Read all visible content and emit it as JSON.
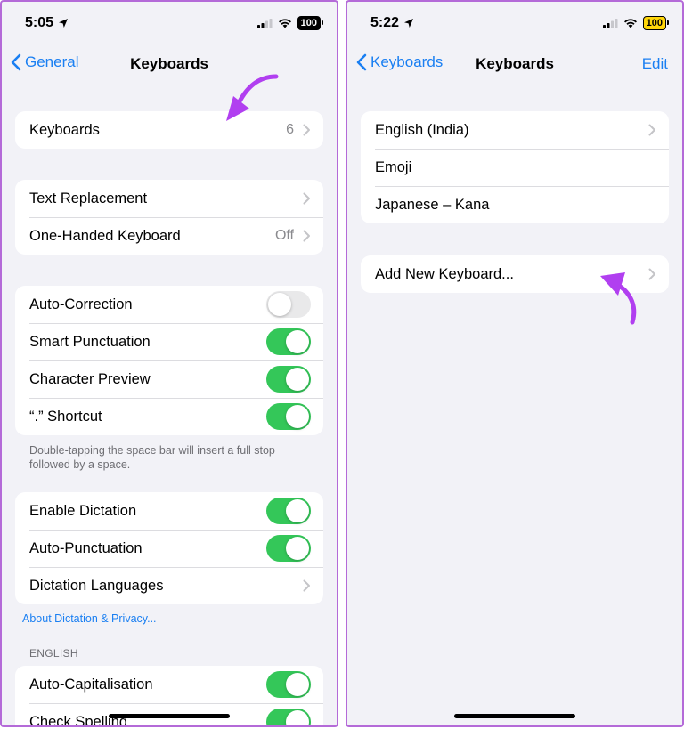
{
  "left": {
    "status": {
      "time": "5:05",
      "battery": "100"
    },
    "nav": {
      "back_label": "General",
      "title": "Keyboards"
    },
    "keyboards_row": {
      "label": "Keyboards",
      "value": "6"
    },
    "group2": [
      {
        "label": "Text Replacement",
        "value": ""
      },
      {
        "label": "One-Handed Keyboard",
        "value": "Off"
      }
    ],
    "group3": [
      {
        "label": "Auto-Correction",
        "toggle": false
      },
      {
        "label": "Smart Punctuation",
        "toggle": true
      },
      {
        "label": "Character Preview",
        "toggle": true
      },
      {
        "label": "“.” Shortcut",
        "toggle": true
      }
    ],
    "footnote": "Double-tapping the space bar will insert a full stop followed by a space.",
    "group4": [
      {
        "label": "Enable Dictation",
        "toggle": true
      },
      {
        "label": "Auto-Punctuation",
        "toggle": true
      },
      {
        "label": "Dictation Languages"
      }
    ],
    "privacy_link": "About Dictation & Privacy...",
    "section_header": "ENGLISH",
    "group5": [
      {
        "label": "Auto-Capitalisation",
        "toggle": true
      },
      {
        "label": "Check Spelling",
        "toggle": true
      }
    ]
  },
  "right": {
    "status": {
      "time": "5:22",
      "battery": "100"
    },
    "nav": {
      "back_label": "Keyboards",
      "title": "Keyboards",
      "edit_label": "Edit"
    },
    "keyboard_list": [
      {
        "label": "English (India)"
      },
      {
        "label": "Emoji"
      },
      {
        "label": "Japanese – Kana"
      }
    ],
    "add_keyboard_label": "Add New Keyboard..."
  },
  "colors": {
    "accent": "#1a7ff2",
    "toggle_on": "#34c759",
    "arrow": "#b13ff0",
    "battery_yellow": "#ffd60a"
  }
}
